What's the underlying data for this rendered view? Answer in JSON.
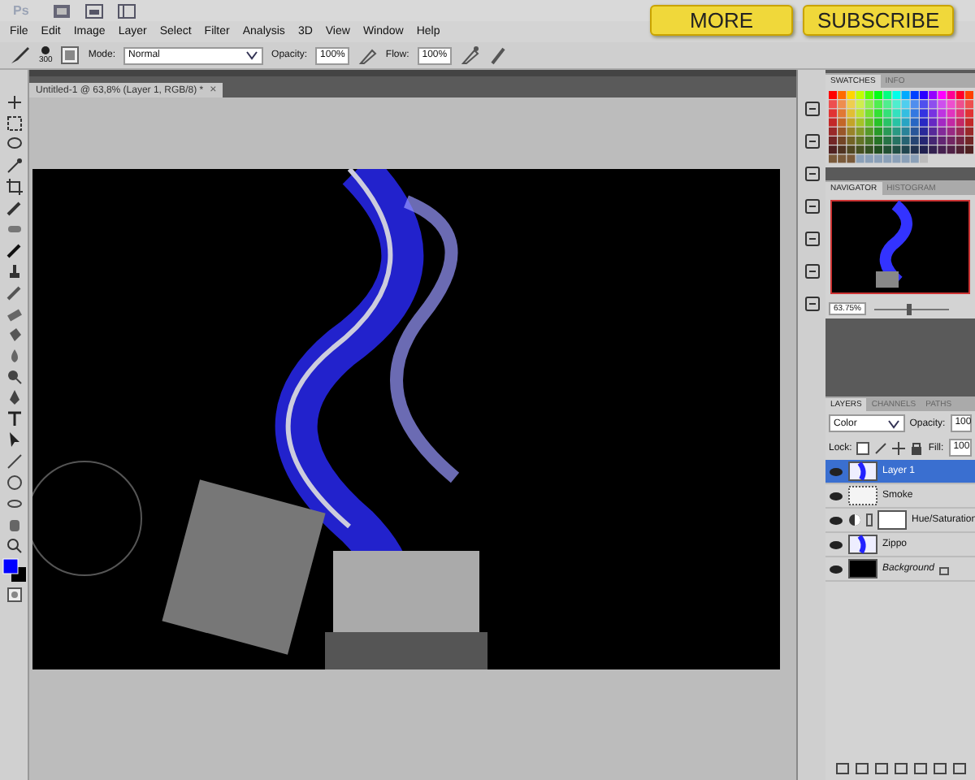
{
  "app_bar": {
    "logo": "Ps"
  },
  "overlay_buttons": [
    "MORE",
    "SUBSCRIBE"
  ],
  "menu": [
    "File",
    "Edit",
    "Image",
    "Layer",
    "Select",
    "Filter",
    "Analysis",
    "3D",
    "View",
    "Window",
    "Help"
  ],
  "options": {
    "size": "300",
    "mode_label": "Mode:",
    "mode": "Normal",
    "opacity_label": "Opacity:",
    "opacity": "100%",
    "flow_label": "Flow:",
    "flow": "100%"
  },
  "document": {
    "tab": "Untitled-1 @ 63,8% (Layer 1, RGB/8) *",
    "close": "×"
  },
  "swatches_panel": {
    "tabs": [
      {
        "label": "SWATCHES",
        "selected": true
      },
      {
        "label": "INFO",
        "selected": false
      }
    ]
  },
  "navigator_panel": {
    "tabs": [
      {
        "label": "NAVIGATOR",
        "selected": true
      },
      {
        "label": "HISTOGRAM",
        "selected": false
      }
    ],
    "zoom": "63.75%",
    "zoom_slider": {
      "level": 0.45
    }
  },
  "layers_panel": {
    "tabs": [
      {
        "label": "LAYERS",
        "selected": true
      },
      {
        "label": "CHANNELS",
        "selected": false
      },
      {
        "label": "PATHS",
        "selected": false
      }
    ],
    "blend_mode": "Color",
    "opacity_label": "Opacity:",
    "opacity": "100",
    "lock_label": "Lock:",
    "fill_label": "Fill:",
    "fill": "100",
    "layers": [
      {
        "name": "Layer 1",
        "kind": "image",
        "selected": true,
        "visible": true
      },
      {
        "name": "Smoke",
        "kind": "transparent",
        "selected": false,
        "visible": true
      },
      {
        "name": "Hue/Saturation",
        "kind": "adjustment",
        "selected": false,
        "visible": true
      },
      {
        "name": "Zippo",
        "kind": "image",
        "selected": false,
        "visible": true
      },
      {
        "name": "Background",
        "kind": "background",
        "selected": false,
        "visible": true
      }
    ]
  }
}
